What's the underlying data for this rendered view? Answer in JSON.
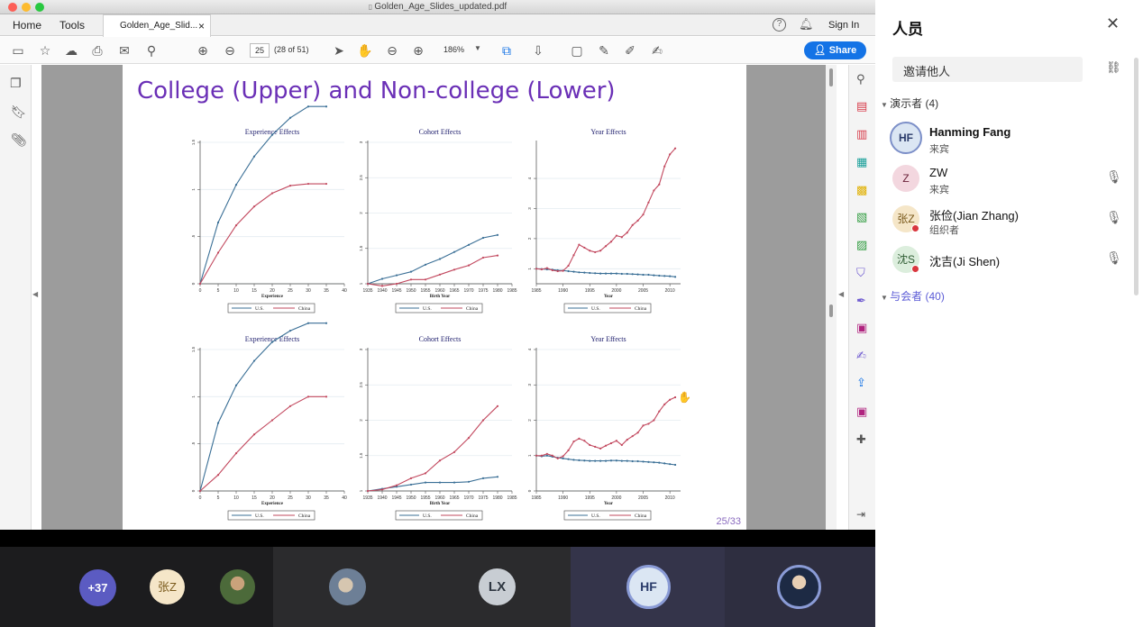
{
  "window": {
    "title": "Golden_Age_Slides_updated.pdf"
  },
  "menu": {
    "home": "Home",
    "tools": "Tools",
    "doc_tab": "Golden_Age_Slid...",
    "sign_in": "Sign In"
  },
  "toolbar": {
    "page_current": "25",
    "page_total": "(28 of 51)",
    "zoom": "186%",
    "share": "Share"
  },
  "slide": {
    "title": "College (Upper) and Non-college (Lower)",
    "page_number": "25/33"
  },
  "legend": {
    "a": "U.S.",
    "b": "China"
  },
  "charts": [
    {
      "title": "Experience Effects",
      "xlabel": "Experience",
      "xticks": [
        "0",
        "5",
        "10",
        "15",
        "20",
        "25",
        "30",
        "35",
        "40"
      ],
      "yticks": [
        "0",
        ".5",
        "1",
        "1.5"
      ]
    },
    {
      "title": "Cohort Effects",
      "xlabel": "Birth Year",
      "xticks": [
        "1935",
        "1940",
        "1945",
        "1950",
        "1955",
        "1960",
        "1965",
        "1970",
        "1975",
        "1980",
        "1985"
      ],
      "yticks": [
        "1",
        "1.5",
        "2",
        "2.5",
        "3"
      ]
    },
    {
      "title": "Year Effects",
      "xlabel": "Year",
      "xticks": [
        "1985",
        "1990",
        "1995",
        "2000",
        "2005",
        "2010"
      ],
      "yticks": [
        "1",
        "2",
        "3",
        "4"
      ]
    },
    {
      "title": "Experience Effects",
      "xlabel": "Experience",
      "xticks": [
        "0",
        "5",
        "10",
        "15",
        "20",
        "25",
        "30",
        "35",
        "40"
      ],
      "yticks": [
        "0",
        ".5",
        "1",
        "1.5"
      ]
    },
    {
      "title": "Cohort Effects",
      "xlabel": "Birth Year",
      "xticks": [
        "1935",
        "1940",
        "1945",
        "1950",
        "1955",
        "1960",
        "1965",
        "1970",
        "1975",
        "1980",
        "1985"
      ],
      "yticks": [
        "1",
        "1.5",
        "2",
        "2.5",
        "3"
      ]
    },
    {
      "title": "Year Effects",
      "xlabel": "Year",
      "xticks": [
        "1985",
        "1990",
        "1995",
        "2000",
        "2005",
        "2010"
      ],
      "yticks": [
        "0",
        "1",
        "2",
        "3",
        "4"
      ]
    }
  ],
  "chart_data": [
    {
      "type": "line",
      "title": "Experience Effects",
      "xlabel": "Experience",
      "ylabel": "",
      "xlim": [
        0,
        40
      ],
      "ylim": [
        0,
        1.5
      ],
      "x": [
        0,
        5,
        10,
        15,
        20,
        25,
        30,
        35
      ],
      "series": [
        {
          "name": "U.S.",
          "values": [
            0,
            0.65,
            1.05,
            1.35,
            1.58,
            1.76,
            1.88,
            1.88
          ]
        },
        {
          "name": "China",
          "values": [
            0,
            0.33,
            0.62,
            0.82,
            0.96,
            1.04,
            1.06,
            1.06
          ]
        }
      ]
    },
    {
      "type": "line",
      "title": "Cohort Effects",
      "xlabel": "Birth Year",
      "ylabel": "",
      "xlim": [
        1935,
        1985
      ],
      "ylim": [
        1,
        3
      ],
      "x": [
        1935,
        1940,
        1945,
        1950,
        1955,
        1960,
        1965,
        1970,
        1975,
        1980
      ],
      "series": [
        {
          "name": "U.S.",
          "values": [
            1.0,
            1.07,
            1.12,
            1.17,
            1.27,
            1.35,
            1.45,
            1.55,
            1.65,
            1.69
          ]
        },
        {
          "name": "China",
          "values": [
            1.0,
            0.97,
            1.0,
            1.06,
            1.06,
            1.13,
            1.2,
            1.26,
            1.37,
            1.4
          ]
        }
      ]
    },
    {
      "type": "line",
      "title": "Year Effects",
      "xlabel": "Year",
      "ylabel": "",
      "xlim": [
        1985,
        2012
      ],
      "ylim": [
        0.5,
        5.2
      ],
      "x": [
        1985,
        1986,
        1987,
        1988,
        1989,
        1990,
        1991,
        1992,
        1993,
        1994,
        1995,
        1996,
        1997,
        1998,
        1999,
        2000,
        2001,
        2002,
        2003,
        2004,
        2005,
        2006,
        2007,
        2008,
        2009,
        2010,
        2011
      ],
      "series": [
        {
          "name": "U.S.",
          "values": [
            1.0,
            0.99,
            0.98,
            0.97,
            0.95,
            0.94,
            0.92,
            0.9,
            0.88,
            0.87,
            0.86,
            0.85,
            0.84,
            0.84,
            0.84,
            0.84,
            0.83,
            0.83,
            0.82,
            0.81,
            0.8,
            0.8,
            0.78,
            0.77,
            0.76,
            0.75,
            0.73
          ]
        },
        {
          "name": "China",
          "values": [
            1.0,
            0.98,
            1.02,
            0.95,
            0.92,
            0.93,
            1.1,
            1.45,
            1.8,
            1.7,
            1.6,
            1.55,
            1.6,
            1.75,
            1.9,
            2.1,
            2.05,
            2.2,
            2.45,
            2.6,
            2.8,
            3.2,
            3.6,
            3.8,
            4.4,
            4.8,
            5.0
          ]
        }
      ]
    },
    {
      "type": "line",
      "title": "Experience Effects",
      "xlabel": "Experience",
      "ylabel": "",
      "xlim": [
        0,
        40
      ],
      "ylim": [
        0,
        1.5
      ],
      "x": [
        0,
        5,
        10,
        15,
        20,
        25,
        30,
        35
      ],
      "series": [
        {
          "name": "U.S.",
          "values": [
            0,
            0.72,
            1.12,
            1.38,
            1.58,
            1.7,
            1.78,
            1.78
          ]
        },
        {
          "name": "China",
          "values": [
            0,
            0.17,
            0.4,
            0.6,
            0.75,
            0.9,
            1.0,
            1.0
          ]
        }
      ]
    },
    {
      "type": "line",
      "title": "Cohort Effects",
      "xlabel": "Birth Year",
      "ylabel": "",
      "xlim": [
        1935,
        1985
      ],
      "ylim": [
        1,
        3
      ],
      "x": [
        1935,
        1940,
        1945,
        1950,
        1955,
        1960,
        1965,
        1970,
        1975,
        1980
      ],
      "series": [
        {
          "name": "U.S.",
          "values": [
            1.0,
            1.03,
            1.06,
            1.09,
            1.12,
            1.12,
            1.12,
            1.13,
            1.18,
            1.2
          ]
        },
        {
          "name": "China",
          "values": [
            1.0,
            1.02,
            1.08,
            1.18,
            1.25,
            1.43,
            1.55,
            1.75,
            2.0,
            2.2
          ]
        }
      ]
    },
    {
      "type": "line",
      "title": "Year Effects",
      "xlabel": "Year",
      "ylabel": "",
      "xlim": [
        1985,
        2012
      ],
      "ylim": [
        0,
        4
      ],
      "x": [
        1985,
        1986,
        1987,
        1988,
        1989,
        1990,
        1991,
        1992,
        1993,
        1994,
        1995,
        1996,
        1997,
        1998,
        1999,
        2000,
        2001,
        2002,
        2003,
        2004,
        2005,
        2006,
        2007,
        2008,
        2009,
        2010,
        2011
      ],
      "series": [
        {
          "name": "U.S.",
          "values": [
            1.0,
            0.98,
            1.0,
            0.97,
            0.94,
            0.92,
            0.9,
            0.88,
            0.87,
            0.86,
            0.85,
            0.85,
            0.85,
            0.85,
            0.86,
            0.86,
            0.85,
            0.85,
            0.84,
            0.84,
            0.83,
            0.82,
            0.81,
            0.8,
            0.78,
            0.76,
            0.74
          ]
        },
        {
          "name": "China",
          "values": [
            1.0,
            1.0,
            1.05,
            1.0,
            0.92,
            0.98,
            1.15,
            1.4,
            1.48,
            1.42,
            1.3,
            1.25,
            1.2,
            1.28,
            1.35,
            1.42,
            1.3,
            1.45,
            1.55,
            1.65,
            1.85,
            1.9,
            2.0,
            2.25,
            2.45,
            2.58,
            2.65
          ]
        }
      ]
    }
  ],
  "panel": {
    "title": "人员",
    "invite_placeholder": "邀请他人",
    "presenters_label": "演示者 (4)",
    "attendees_label": "与会者 (40)",
    "people": [
      {
        "initials": "HF",
        "name": "Hanming Fang",
        "role": "来宾"
      },
      {
        "initials": "Z",
        "name": "ZW",
        "role": "来宾"
      },
      {
        "initials": "张Z",
        "name": "张俭(Jian Zhang)",
        "role": "组织者"
      },
      {
        "initials": "沈S",
        "name": "沈吉(Ji Shen)",
        "role": ""
      }
    ]
  },
  "gallery": {
    "more": "+37",
    "zhang": "张Z",
    "lx": "LX",
    "hf": "HF"
  },
  "colors": {
    "us": "#3a6f96",
    "china": "#c2485e",
    "accent": "#1473e6",
    "title": "#6a2fb6"
  }
}
